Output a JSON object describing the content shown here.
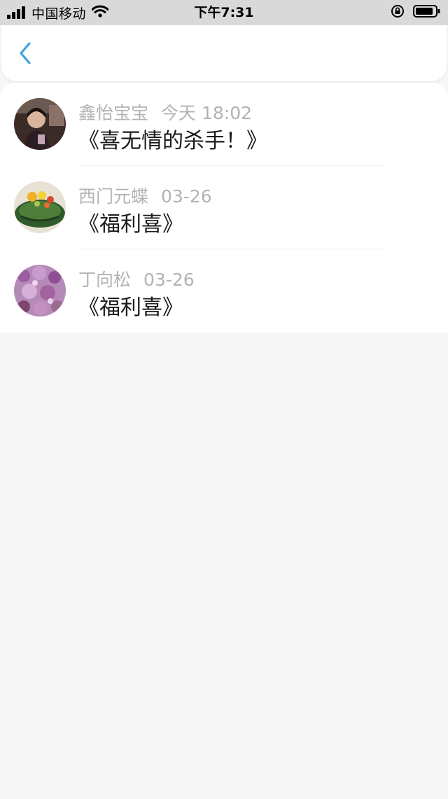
{
  "status_bar": {
    "carrier": "中国移动",
    "time": "下午7:31"
  },
  "nav": {
    "back_icon": "chevron-left-icon",
    "accent_color": "#3a9fe0"
  },
  "items": [
    {
      "user": "鑫怡宝宝",
      "time": "今天 18:02",
      "title": "《喜无情的杀手！》"
    },
    {
      "user": "西门元蝶",
      "time": "03-26",
      "title": "《福利喜》"
    },
    {
      "user": "丁向松",
      "time": "03-26",
      "title": "《福利喜》"
    }
  ]
}
